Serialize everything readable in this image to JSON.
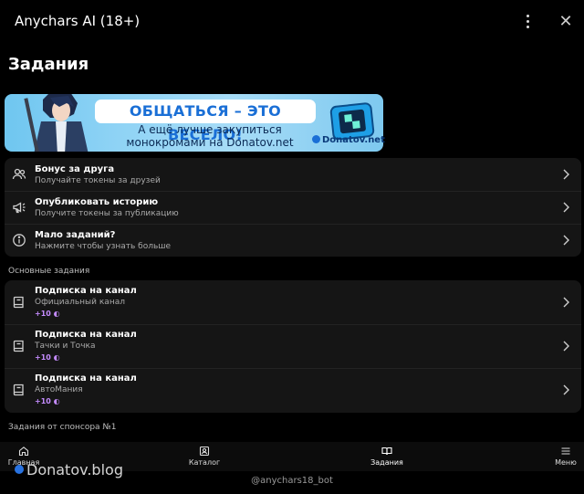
{
  "header": {
    "title": "Anychars AI (18+)",
    "close_glyph": "✕"
  },
  "page_title": "Задания",
  "banner": {
    "headline": "ОБЩАТЬСЯ – ЭТО ВЕСЕЛО!",
    "line1": "А ещё лучше закупиться",
    "line2": "монокромами на Donatov.net",
    "logo": "Donatov.net"
  },
  "top_tasks": [
    {
      "title": "Бонус за друга",
      "subtitle": "Получайте токены за друзей",
      "icon": "users-icon"
    },
    {
      "title": "Опубликовать историю",
      "subtitle": "Получите токены за публикацию",
      "icon": "megaphone-icon"
    },
    {
      "title": "Мало заданий?",
      "subtitle": "Нажмите чтобы узнать больше",
      "icon": "info-icon"
    }
  ],
  "main_section_label": "Основные задания",
  "main_tasks": [
    {
      "title": "Подписка на канал",
      "subtitle": "Официальный канал",
      "reward": "+10",
      "icon": "book-icon"
    },
    {
      "title": "Подписка на канал",
      "subtitle": "Тачки и Точка",
      "reward": "+10",
      "icon": "book-icon"
    },
    {
      "title": "Подписка на канал",
      "subtitle": "АвтоМания",
      "reward": "+10",
      "icon": "book-icon"
    }
  ],
  "sponsor_section_label": "Задания от спонсора №1",
  "nav": {
    "items": [
      {
        "label": "Главная",
        "icon": "home-icon"
      },
      {
        "label": "Каталог",
        "icon": "catalog-icon"
      },
      {
        "label": "Задания",
        "icon": "tasks-icon",
        "active": true
      },
      {
        "label": "Меню",
        "icon": "menu-icon"
      }
    ]
  },
  "watermark": "Donatov.blog",
  "footer": "@anychars18_bot",
  "colors": {
    "background": "#000000",
    "card": "#151515",
    "reward": "#c58cff",
    "banner_blue": "#1a6fd6"
  }
}
